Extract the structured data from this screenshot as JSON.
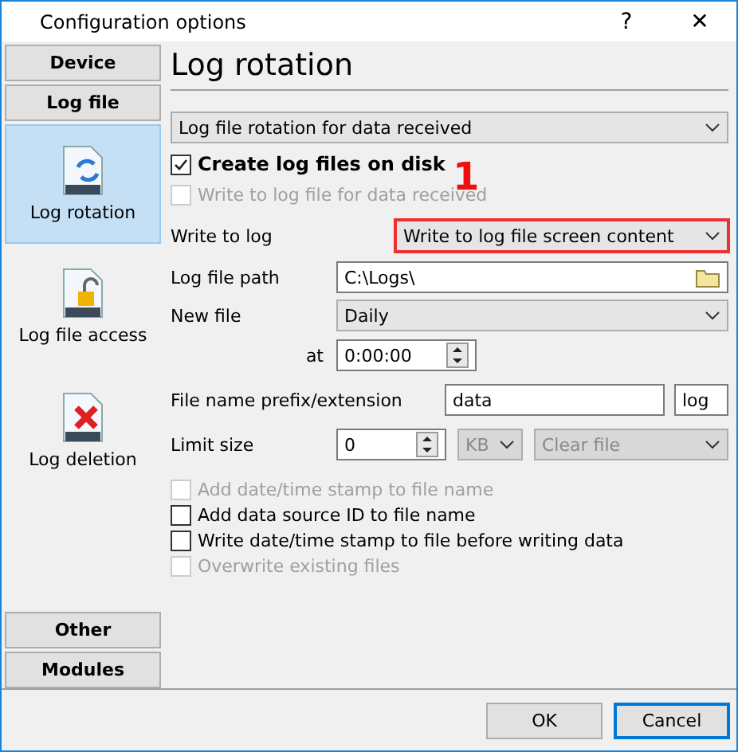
{
  "window": {
    "title": "Configuration options",
    "help": "?",
    "close": "✕"
  },
  "sidebar": {
    "groups": [
      {
        "label": "Device"
      },
      {
        "label": "Log file",
        "items": [
          {
            "label": "Log rotation",
            "kind": "rotate",
            "selected": true
          },
          {
            "label": "Log file access",
            "kind": "lock",
            "selected": false
          },
          {
            "label": "Log deletion",
            "kind": "delete",
            "selected": false
          }
        ]
      },
      {
        "label": "Other"
      },
      {
        "label": "Modules"
      }
    ]
  },
  "page": {
    "title": "Log rotation",
    "mode_dropdown": {
      "value": "Log file rotation for data received"
    },
    "create_checkbox": {
      "label": "Create log files on disk",
      "checked": true,
      "disabled": false
    },
    "received_checkbox": {
      "label": "Write to log file for data received",
      "checked": false,
      "disabled": true
    },
    "write_to_log": {
      "label": "Write to log",
      "value": "Write to log file screen content",
      "highlighted": true,
      "annotation": "1"
    },
    "log_path": {
      "label": "Log file path",
      "value": "C:\\Logs\\"
    },
    "new_file": {
      "label": "New file",
      "value": "Daily"
    },
    "at": {
      "label": "at",
      "value": "0:00:00"
    },
    "prefix": {
      "label": "File name prefix/extension",
      "value": "data",
      "extension": "log"
    },
    "limit": {
      "label": "Limit size",
      "value": "0",
      "unit": "KB",
      "unit_disabled": true,
      "action": "Clear file",
      "action_disabled": true
    },
    "options": [
      {
        "label": "Add date/time stamp to file name",
        "checked": false,
        "disabled": true
      },
      {
        "label": "Add data source ID to file name",
        "checked": false,
        "disabled": false
      },
      {
        "label": "Write date/time stamp to file before writing data",
        "checked": false,
        "disabled": false
      },
      {
        "label": "Overwrite existing files",
        "checked": false,
        "disabled": true
      }
    ]
  },
  "buttons": [
    {
      "label": "OK",
      "default": false
    },
    {
      "label": "Cancel",
      "default": true
    }
  ]
}
